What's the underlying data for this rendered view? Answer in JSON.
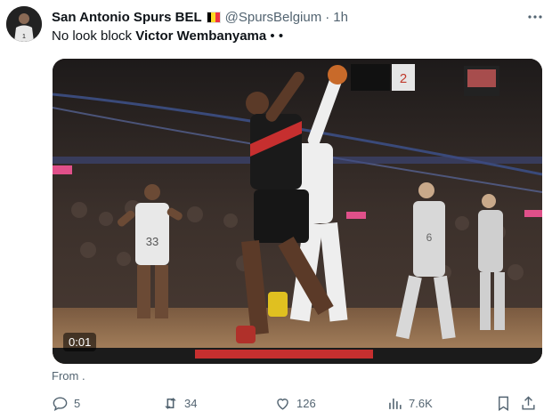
{
  "tweet": {
    "author_name": "San Antonio Spurs BEL",
    "handle": "@SpursBelgium",
    "separator": "·",
    "time": "1h",
    "text_prefix": "No look block ",
    "text_bold": "Victor Wembanyama",
    "text_suffix": " • •"
  },
  "video": {
    "timecode": "0:01",
    "scoreboard_number": "2"
  },
  "source_label": "From .",
  "actions": {
    "replies": "5",
    "reposts": "34",
    "likes": "126",
    "views": "7.6K"
  },
  "colors": {
    "text_primary": "#0f1419",
    "text_secondary": "#536471",
    "flag": [
      "#000000",
      "#fdda24",
      "#ef3340"
    ]
  },
  "icons": [
    "more-icon",
    "reply-icon",
    "repost-icon",
    "like-icon",
    "views-icon",
    "bookmark-icon",
    "share-icon"
  ]
}
